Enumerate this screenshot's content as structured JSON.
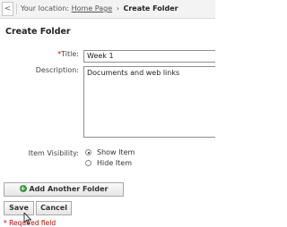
{
  "breadcrumb": {
    "back_symbol": "<",
    "prefix": "Your location:",
    "home_link": "Home Page",
    "separator": "›",
    "current": "Create Folder"
  },
  "form": {
    "heading": "Create Folder",
    "title_label": "Title:",
    "title_required_marker": "*",
    "title_value": "Week 1",
    "description_label": "Description:",
    "description_value": "Documents and web links",
    "visibility_label": "Item Visibility:",
    "visibility_options": [
      {
        "label": "Show Item",
        "selected": true
      },
      {
        "label": "Hide Item",
        "selected": false
      }
    ]
  },
  "buttons": {
    "add_another": "Add Another Folder",
    "save": "Save",
    "cancel": "Cancel"
  },
  "footer": {
    "required_note": "* Required field"
  },
  "icons": {
    "add": "plus-circle-icon",
    "back": "chevron-left-icon",
    "cursor": "mouse-pointer-icon"
  },
  "colors": {
    "required": "#cc0000",
    "add_icon": "#3a9a3a"
  }
}
